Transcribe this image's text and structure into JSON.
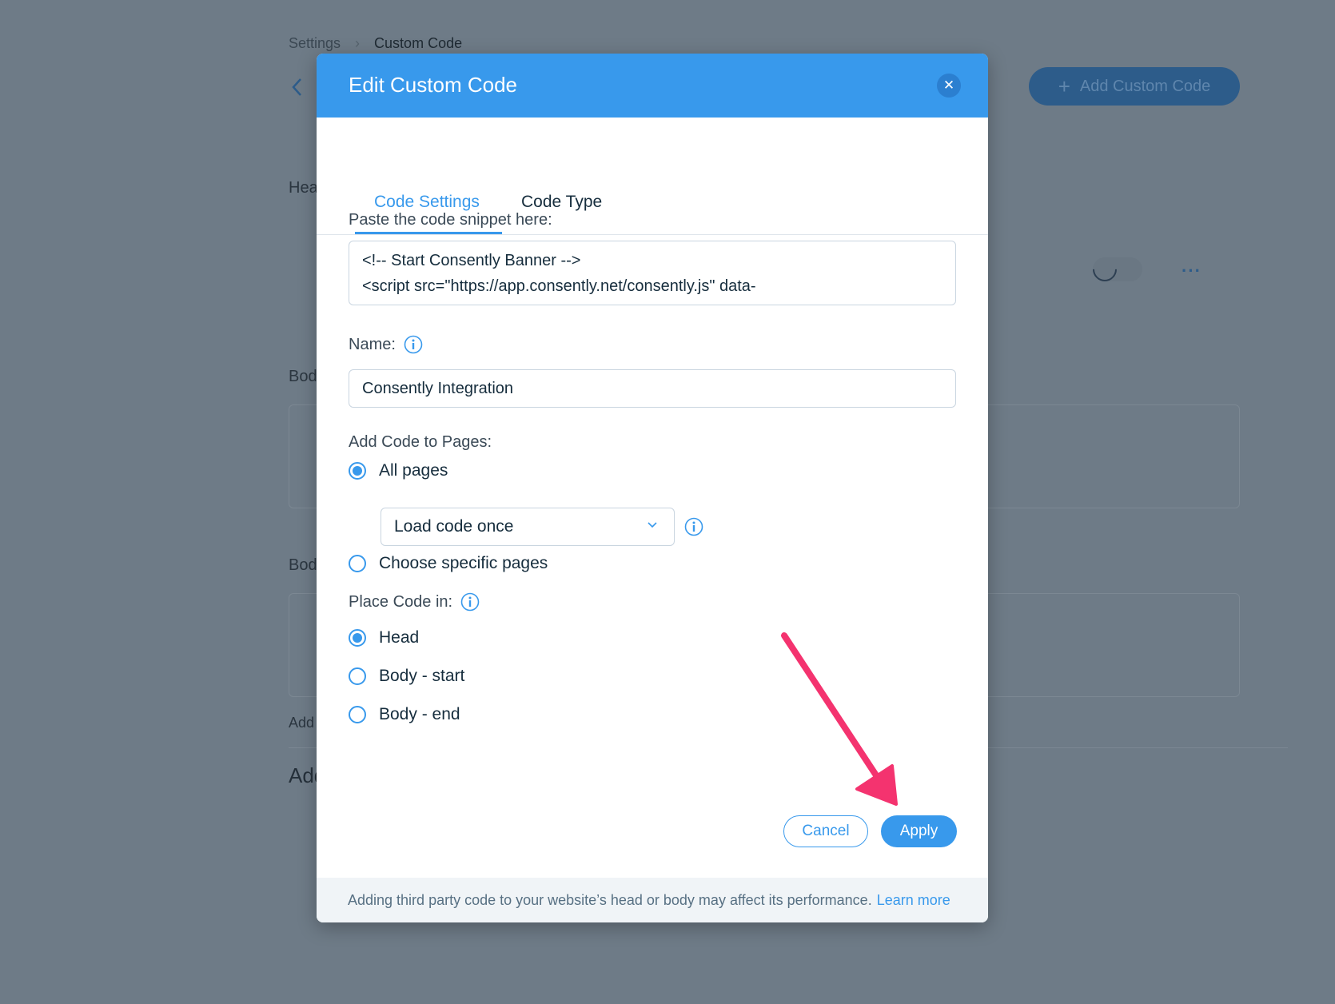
{
  "background": {
    "breadcrumb": {
      "root": "Settings",
      "current": "Custom Code"
    },
    "add_button_label": "Add Custom Code",
    "section_labels": [
      "Hea",
      "Bod",
      "Bod",
      "Add"
    ],
    "heading_fragment": "Add"
  },
  "modal": {
    "title": "Edit Custom Code",
    "tabs": [
      {
        "label": "Code Settings",
        "active": true
      },
      {
        "label": "Code Type",
        "active": false
      }
    ],
    "snippet": {
      "label": "Paste the code snippet here:",
      "lines": [
        "<!-- Start Consently Banner -->",
        "<script src=\"https://app.consently.net/consently.js\" data-"
      ]
    },
    "name": {
      "label": "Name:",
      "value": "Consently Integration"
    },
    "pages": {
      "label": "Add Code to Pages:",
      "options": [
        {
          "label": "All pages",
          "checked": true
        },
        {
          "label": "Choose specific pages",
          "checked": false
        }
      ],
      "load_mode": "Load code once"
    },
    "placement": {
      "label": "Place Code in:",
      "options": [
        {
          "label": "Head",
          "checked": true
        },
        {
          "label": "Body - start",
          "checked": false
        },
        {
          "label": "Body - end",
          "checked": false
        }
      ]
    },
    "buttons": {
      "cancel": "Cancel",
      "apply": "Apply"
    },
    "footer": {
      "text": "Adding third party code to your website’s head or body may affect its performance.",
      "link": "Learn more"
    }
  },
  "colors": {
    "accent": "#3899ec",
    "overlay": "#6e7b87",
    "annotation": "#f4336f"
  },
  "icons": {
    "close": "close-icon",
    "info": "info-icon",
    "chevron": "chevron-down-icon",
    "back": "chevron-left-icon",
    "plus": "plus-icon"
  }
}
